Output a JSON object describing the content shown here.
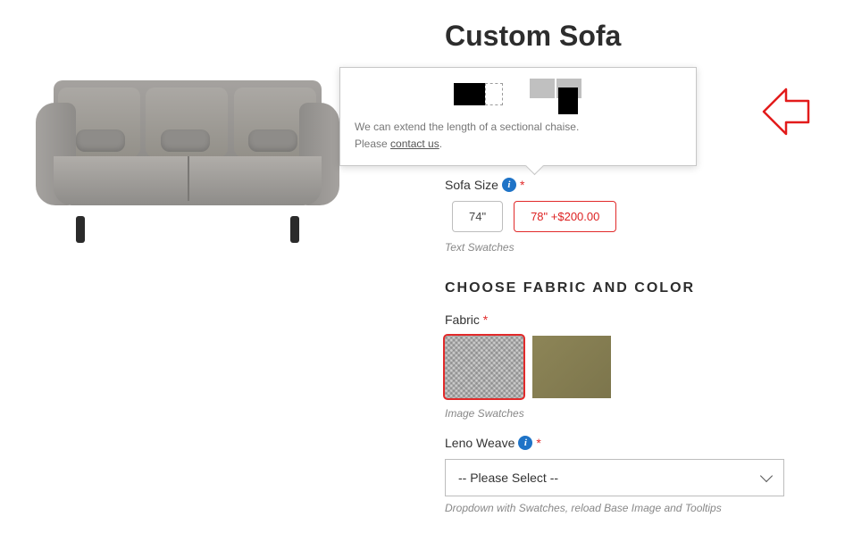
{
  "product": {
    "title": "Custom Sofa"
  },
  "tooltip": {
    "line1": "We can extend the length of a sectional chaise.",
    "line2_prefix": "Please ",
    "contact_link": "contact us",
    "line2_suffix": "."
  },
  "sofa_size": {
    "label": "Sofa Size",
    "options": [
      {
        "text": "74\""
      },
      {
        "text": "78\" +$200.00"
      }
    ],
    "helper": "Text Swatches"
  },
  "fabric_section": {
    "heading": "CHOOSE FABRIC AND COLOR",
    "fabric_label": "Fabric",
    "helper": "Image Swatches"
  },
  "leno": {
    "label": "Leno Weave",
    "placeholder": "-- Please Select --",
    "helper": "Dropdown with Swatches, reload Base Image and Tooltips"
  },
  "required_mark": "*"
}
